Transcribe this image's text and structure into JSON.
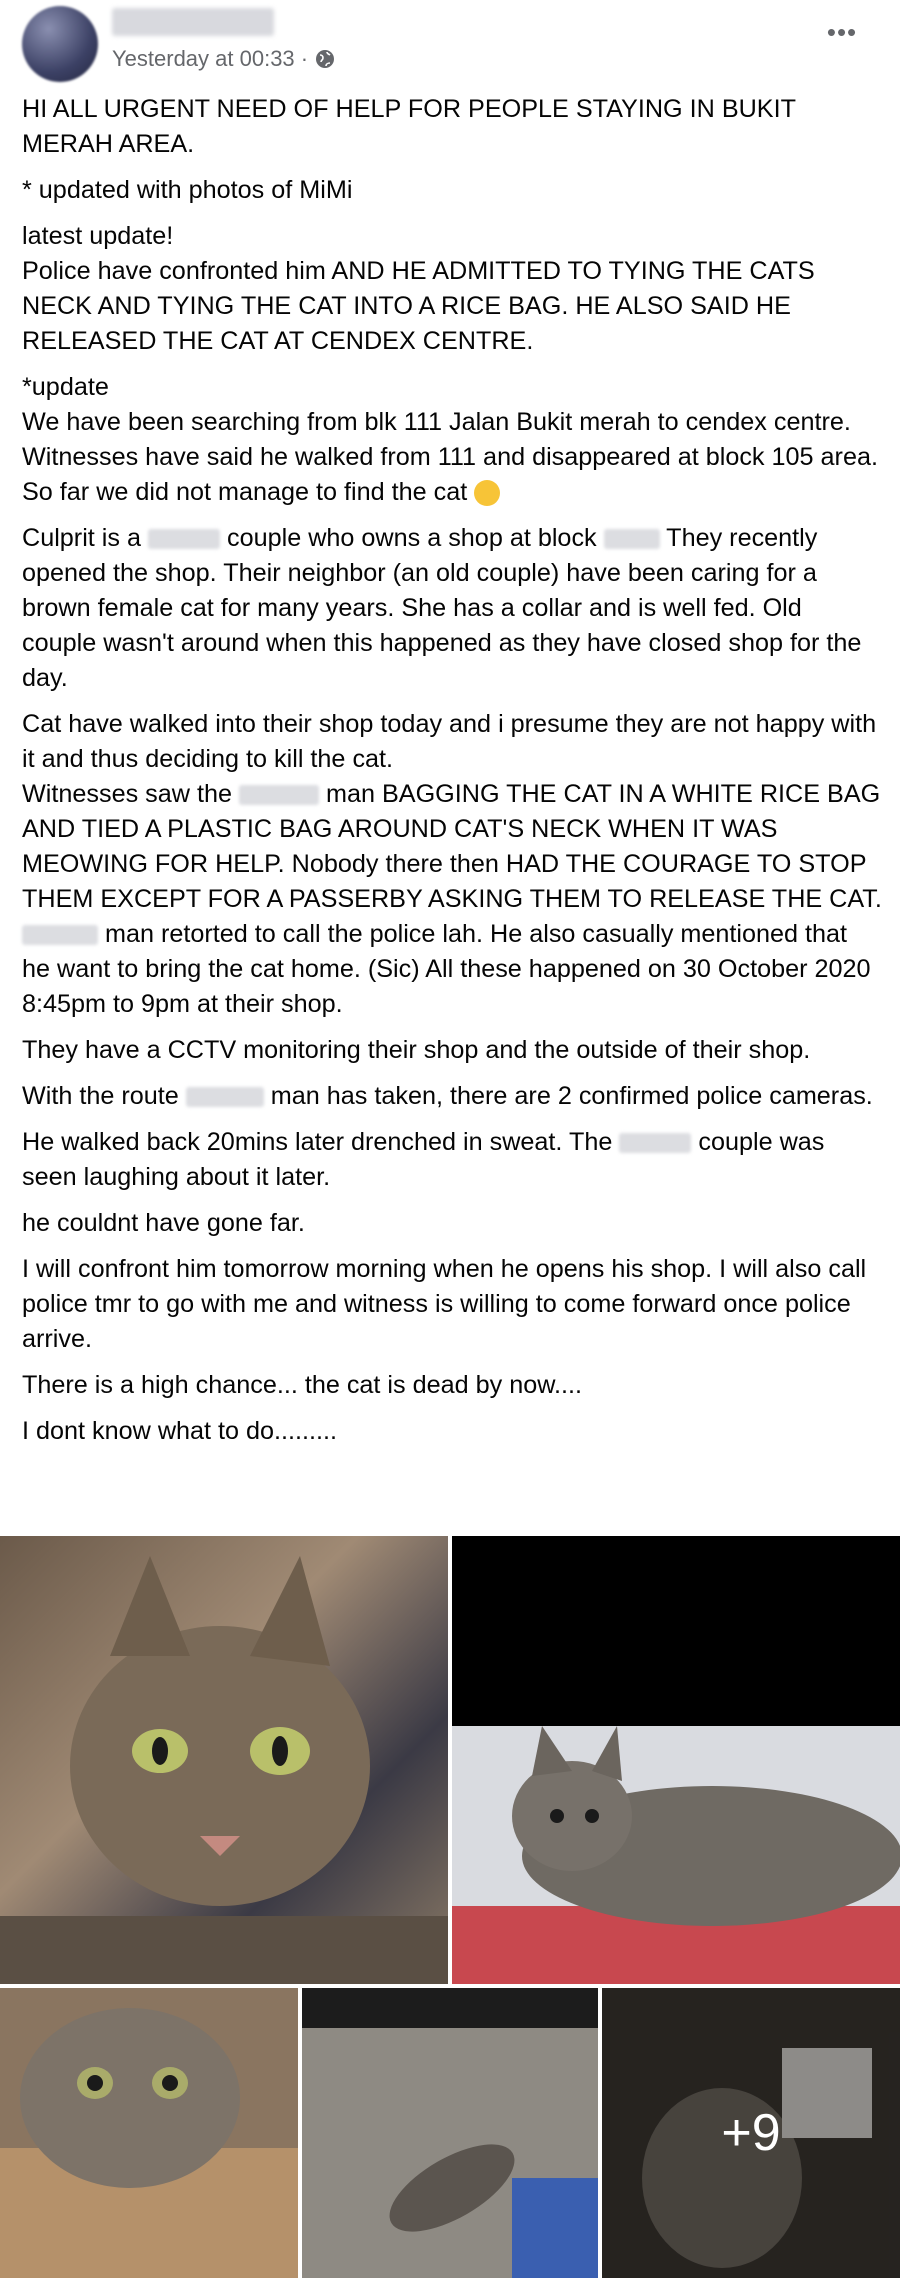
{
  "post": {
    "timestamp": "Yesterday at 00:33 · ",
    "more_label": "•••",
    "paragraphs": [
      [
        "HI ALL URGENT NEED OF HELP FOR PEOPLE STAYING IN BUKIT MERAH AREA."
      ],
      [
        "* updated with photos of MiMi"
      ],
      [
        "latest update!\nPolice have confronted him AND HE ADMITTED TO TYING THE CATS NECK AND TYING THE CAT INTO A RICE BAG. HE ALSO SAID HE RELEASED THE CAT AT CENDEX CENTRE."
      ],
      [
        "*update\nWe have been searching from blk 111 Jalan Bukit merah to cendex centre. Witnesses have said he walked from 111 and disappeared at block 105 area. So far we did not manage to find the cat "
      ],
      [
        "Culprit is a ",
        " couple who owns a shop at block ",
        " They recently opened the shop. Their neighbor (an old couple) have been caring for a brown female cat for many years. She has a collar and is well fed. Old couple wasn't around when this happened as they have closed shop for the day."
      ],
      [
        "Cat have walked into their shop today and i presume they are not happy with it and thus deciding to kill the cat.\nWitnesses saw the ",
        " man BAGGING THE CAT IN A WHITE RICE BAG AND TIED A PLASTIC BAG AROUND CAT'S NECK WHEN IT WAS MEOWING FOR HELP. Nobody there then HAD THE COURAGE TO STOP THEM EXCEPT FOR A PASSERBY ASKING THEM TO RELEASE THE CAT. ",
        " man retorted to call the police lah. He also casually mentioned that he want to bring the cat home. (Sic) All these happened on 30 October 2020 8:45pm to 9pm at their shop."
      ],
      [
        "They have a CCTV monitoring their shop and the outside of their shop."
      ],
      [
        "With the route ",
        " man has taken, there are 2 confirmed police cameras."
      ],
      [
        "He walked back 20mins later drenched in sweat. The ",
        " couple was seen laughing about it later."
      ],
      [
        "he couldnt have gone far."
      ],
      [
        "I will confront him tomorrow morning when he opens his shop. I will also call police tmr to go with me and witness is willing to come forward once police arrive."
      ],
      [
        "There is a high chance... the cat is dead by now...."
      ],
      [
        "I dont know what to do........."
      ]
    ],
    "more_photos_label": "+9"
  },
  "icons": {
    "privacy": "globe-icon",
    "emoji": "crying-face-icon",
    "menu": "more-options-icon"
  }
}
